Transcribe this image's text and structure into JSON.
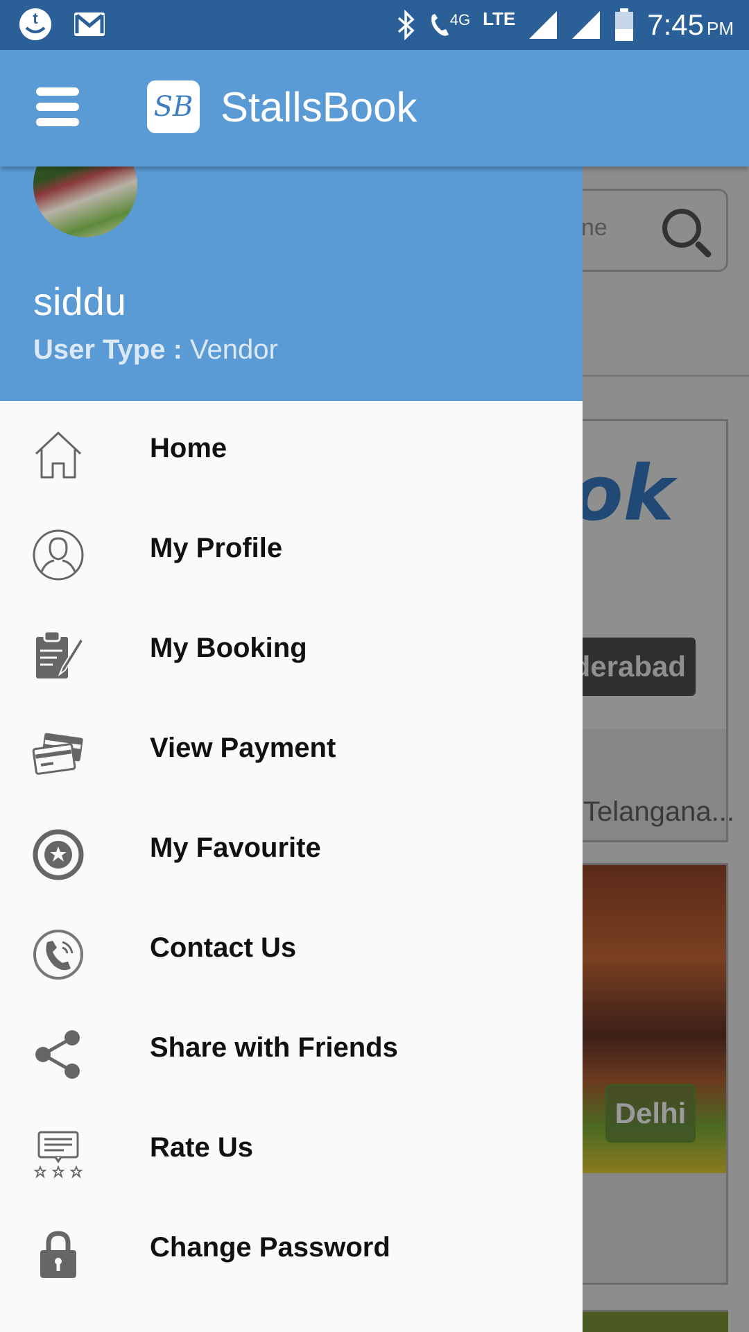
{
  "status_bar": {
    "network": "4G",
    "lte": "LTE",
    "time": "7:45",
    "ampm": "PM"
  },
  "app_bar": {
    "logo_text": "SB",
    "title": "StallsBook"
  },
  "drawer": {
    "username": "siddu",
    "user_type_label": "User Type :",
    "user_type_value": "Vendor",
    "items": [
      {
        "label": "Home",
        "icon": "home-icon"
      },
      {
        "label": "My Profile",
        "icon": "profile-icon"
      },
      {
        "label": "My Booking",
        "icon": "booking-icon"
      },
      {
        "label": "View Payment",
        "icon": "payment-icon"
      },
      {
        "label": "My Favourite",
        "icon": "favourite-icon"
      },
      {
        "label": "Contact Us",
        "icon": "phone-icon"
      },
      {
        "label": "Share with Friends",
        "icon": "share-icon"
      },
      {
        "label": "Rate Us",
        "icon": "rate-icon"
      },
      {
        "label": "Change Password",
        "icon": "lock-icon"
      }
    ]
  },
  "background": {
    "search_placeholder_fragment": "ne",
    "logo_fragment": "ok",
    "card1_city": "derabad",
    "card1_location": "Telangana...",
    "card2_city": "Delhi"
  },
  "colors": {
    "status_bar": "#2a5f97",
    "primary": "#5b9bd5",
    "drawer_bg": "#fafafa",
    "icon": "#666666"
  }
}
